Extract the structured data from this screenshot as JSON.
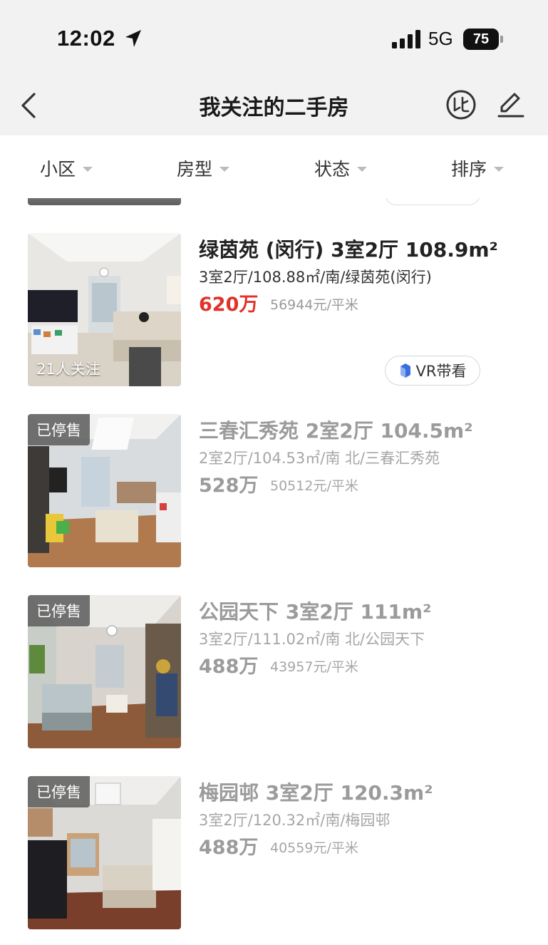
{
  "status_bar": {
    "time": "12:02",
    "network": "5G",
    "battery": "75"
  },
  "nav": {
    "title": "我关注的二手房"
  },
  "filters": [
    {
      "label": "小区"
    },
    {
      "label": "房型"
    },
    {
      "label": "状态"
    },
    {
      "label": "排序"
    }
  ],
  "listings": [
    {
      "title": "绿茵苑 (闵行) 3室2厅 108.9m²",
      "subtitle": "3室2厅/108.88㎡/南/绿茵苑(闵行)",
      "price": "620万",
      "unit_price": "56944元/平米",
      "follow_count": "21人关注",
      "vr_label": "VR带看",
      "status": "active"
    },
    {
      "title": "三春汇秀苑 2室2厅 104.5m²",
      "subtitle": "2室2厅/104.53㎡/南 北/三春汇秀苑",
      "price": "528万",
      "unit_price": "50512元/平米",
      "badge": "已停售",
      "status": "stopped"
    },
    {
      "title": "公园天下 3室2厅 111m²",
      "subtitle": "3室2厅/111.02㎡/南 北/公园天下",
      "price": "488万",
      "unit_price": "43957元/平米",
      "badge": "已停售",
      "status": "stopped"
    },
    {
      "title": "梅园邨 3室2厅 120.3m²",
      "subtitle": "3室2厅/120.32㎡/南/梅园邨",
      "price": "488万",
      "unit_price": "40559元/平米",
      "badge": "已停售",
      "status": "stopped"
    }
  ],
  "colors": {
    "price_active": "#e0332b",
    "inactive_text": "#9b9b9b",
    "vr_accent": "#3b6fe0"
  },
  "icons": [
    "back-chevron-icon",
    "compare-icon",
    "edit-pencil-icon",
    "location-arrow-icon",
    "vr-icon"
  ]
}
